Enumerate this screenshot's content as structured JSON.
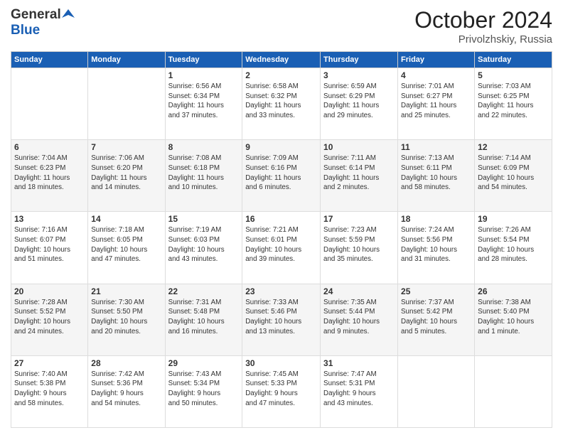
{
  "header": {
    "logo_general": "General",
    "logo_blue": "Blue",
    "title": "October 2024",
    "location": "Privolzhskiy, Russia"
  },
  "days_of_week": [
    "Sunday",
    "Monday",
    "Tuesday",
    "Wednesday",
    "Thursday",
    "Friday",
    "Saturday"
  ],
  "weeks": [
    [
      {
        "day": "",
        "info": ""
      },
      {
        "day": "",
        "info": ""
      },
      {
        "day": "1",
        "info": "Sunrise: 6:56 AM\nSunset: 6:34 PM\nDaylight: 11 hours\nand 37 minutes."
      },
      {
        "day": "2",
        "info": "Sunrise: 6:58 AM\nSunset: 6:32 PM\nDaylight: 11 hours\nand 33 minutes."
      },
      {
        "day": "3",
        "info": "Sunrise: 6:59 AM\nSunset: 6:29 PM\nDaylight: 11 hours\nand 29 minutes."
      },
      {
        "day": "4",
        "info": "Sunrise: 7:01 AM\nSunset: 6:27 PM\nDaylight: 11 hours\nand 25 minutes."
      },
      {
        "day": "5",
        "info": "Sunrise: 7:03 AM\nSunset: 6:25 PM\nDaylight: 11 hours\nand 22 minutes."
      }
    ],
    [
      {
        "day": "6",
        "info": "Sunrise: 7:04 AM\nSunset: 6:23 PM\nDaylight: 11 hours\nand 18 minutes."
      },
      {
        "day": "7",
        "info": "Sunrise: 7:06 AM\nSunset: 6:20 PM\nDaylight: 11 hours\nand 14 minutes."
      },
      {
        "day": "8",
        "info": "Sunrise: 7:08 AM\nSunset: 6:18 PM\nDaylight: 11 hours\nand 10 minutes."
      },
      {
        "day": "9",
        "info": "Sunrise: 7:09 AM\nSunset: 6:16 PM\nDaylight: 11 hours\nand 6 minutes."
      },
      {
        "day": "10",
        "info": "Sunrise: 7:11 AM\nSunset: 6:14 PM\nDaylight: 11 hours\nand 2 minutes."
      },
      {
        "day": "11",
        "info": "Sunrise: 7:13 AM\nSunset: 6:11 PM\nDaylight: 10 hours\nand 58 minutes."
      },
      {
        "day": "12",
        "info": "Sunrise: 7:14 AM\nSunset: 6:09 PM\nDaylight: 10 hours\nand 54 minutes."
      }
    ],
    [
      {
        "day": "13",
        "info": "Sunrise: 7:16 AM\nSunset: 6:07 PM\nDaylight: 10 hours\nand 51 minutes."
      },
      {
        "day": "14",
        "info": "Sunrise: 7:18 AM\nSunset: 6:05 PM\nDaylight: 10 hours\nand 47 minutes."
      },
      {
        "day": "15",
        "info": "Sunrise: 7:19 AM\nSunset: 6:03 PM\nDaylight: 10 hours\nand 43 minutes."
      },
      {
        "day": "16",
        "info": "Sunrise: 7:21 AM\nSunset: 6:01 PM\nDaylight: 10 hours\nand 39 minutes."
      },
      {
        "day": "17",
        "info": "Sunrise: 7:23 AM\nSunset: 5:59 PM\nDaylight: 10 hours\nand 35 minutes."
      },
      {
        "day": "18",
        "info": "Sunrise: 7:24 AM\nSunset: 5:56 PM\nDaylight: 10 hours\nand 31 minutes."
      },
      {
        "day": "19",
        "info": "Sunrise: 7:26 AM\nSunset: 5:54 PM\nDaylight: 10 hours\nand 28 minutes."
      }
    ],
    [
      {
        "day": "20",
        "info": "Sunrise: 7:28 AM\nSunset: 5:52 PM\nDaylight: 10 hours\nand 24 minutes."
      },
      {
        "day": "21",
        "info": "Sunrise: 7:30 AM\nSunset: 5:50 PM\nDaylight: 10 hours\nand 20 minutes."
      },
      {
        "day": "22",
        "info": "Sunrise: 7:31 AM\nSunset: 5:48 PM\nDaylight: 10 hours\nand 16 minutes."
      },
      {
        "day": "23",
        "info": "Sunrise: 7:33 AM\nSunset: 5:46 PM\nDaylight: 10 hours\nand 13 minutes."
      },
      {
        "day": "24",
        "info": "Sunrise: 7:35 AM\nSunset: 5:44 PM\nDaylight: 10 hours\nand 9 minutes."
      },
      {
        "day": "25",
        "info": "Sunrise: 7:37 AM\nSunset: 5:42 PM\nDaylight: 10 hours\nand 5 minutes."
      },
      {
        "day": "26",
        "info": "Sunrise: 7:38 AM\nSunset: 5:40 PM\nDaylight: 10 hours\nand 1 minute."
      }
    ],
    [
      {
        "day": "27",
        "info": "Sunrise: 7:40 AM\nSunset: 5:38 PM\nDaylight: 9 hours\nand 58 minutes."
      },
      {
        "day": "28",
        "info": "Sunrise: 7:42 AM\nSunset: 5:36 PM\nDaylight: 9 hours\nand 54 minutes."
      },
      {
        "day": "29",
        "info": "Sunrise: 7:43 AM\nSunset: 5:34 PM\nDaylight: 9 hours\nand 50 minutes."
      },
      {
        "day": "30",
        "info": "Sunrise: 7:45 AM\nSunset: 5:33 PM\nDaylight: 9 hours\nand 47 minutes."
      },
      {
        "day": "31",
        "info": "Sunrise: 7:47 AM\nSunset: 5:31 PM\nDaylight: 9 hours\nand 43 minutes."
      },
      {
        "day": "",
        "info": ""
      },
      {
        "day": "",
        "info": ""
      }
    ]
  ]
}
